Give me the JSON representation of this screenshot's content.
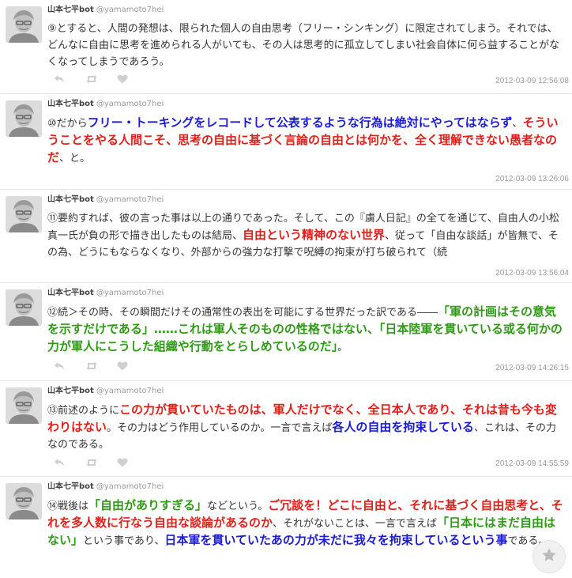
{
  "feed": {
    "tweets": [
      {
        "user_name": "山本七平bot",
        "handle": "@yamamoto7hei",
        "segments": [
          {
            "text": "⑨とすると、人間の発想は、限られた個人の自由思考（フリー・シンキング）に限定されてしまう。それでは、どんなに自由に思考を進められる人がいても、その人は思考的に孤立してしまい社会自体に何ら益することがなくなってしまうであろう。",
            "style": "plain"
          }
        ],
        "timestamp": "2012-03-09 12:56:08"
      },
      {
        "user_name": "山本七平bot",
        "handle": "@yamamoto7hei",
        "segments": [
          {
            "text": "⑩だから",
            "style": "plain"
          },
          {
            "text": "フリー・トーキングをレコードして公表するような行為は絶対にやってはならず",
            "style": "blue"
          },
          {
            "text": "、",
            "style": "plain"
          },
          {
            "text": "そういうことをやる人間こそ、思考の自由に基づく言論の自由とは何かを、全く理解できない愚者なのだ",
            "style": "red"
          },
          {
            "text": "、と。",
            "style": "plain"
          }
        ],
        "timestamp": "2012-03-09 13:26:06"
      },
      {
        "user_name": "山本七平bot",
        "handle": "@yamamoto7hei",
        "segments": [
          {
            "text": "⑪要約すれば、彼の言った事は以上の通りであった。そして、この『虜人日記』の全てを通じて、自由人の小松真一氏が負の形で描き出したものは結局、",
            "style": "plain"
          },
          {
            "text": "自由という精神のない世界",
            "style": "red"
          },
          {
            "text": "、従って「自由な談話」が皆無で、その為、どうにもならなくなり、外部からの強力な打撃で呪縛の拘束が打ち破られて（続",
            "style": "plain"
          }
        ],
        "timestamp": "2012-03-09 13:56:04"
      },
      {
        "user_name": "山本七平bot",
        "handle": "@yamamoto7hei",
        "segments": [
          {
            "text": "⑫続＞その時、その瞬間だけその通常性の表出を可能にする世界だった訳である――",
            "style": "plain"
          },
          {
            "text": "「軍の計画はその意気を示すだけである」……これは軍人そのものの性格ではない、「日本陸軍を貫いている或る何かの力が軍人にこうした組織や行動をとらしめているのだ」",
            "style": "green"
          },
          {
            "text": "。",
            "style": "plain"
          }
        ],
        "timestamp": "2012-03-09 14:26:15"
      },
      {
        "user_name": "山本七平bot",
        "handle": "@yamamoto7hei",
        "segments": [
          {
            "text": "⑬前述のように",
            "style": "plain"
          },
          {
            "text": "この力が貫いていたものは、軍人だけでなく、全日本人であり、それは昔も今も変わりはない",
            "style": "red"
          },
          {
            "text": "。その力はどう作用しているのか。一言で言えば",
            "style": "plain"
          },
          {
            "text": "各人の自由を拘束している",
            "style": "blue"
          },
          {
            "text": "、これは、その力なのである。",
            "style": "plain"
          }
        ],
        "timestamp": "2012-03-09 14:55:59"
      },
      {
        "user_name": "山本七平bot",
        "handle": "@yamamoto7hei",
        "segments": [
          {
            "text": "⑭戦後は",
            "style": "plain"
          },
          {
            "text": "「自由がありすぎる」",
            "style": "green"
          },
          {
            "text": "などという。",
            "style": "plain"
          },
          {
            "text": "ご冗談を！どこに自由と、それに基づく自由思考と、それを多人数に行なう自由な談論があるのか",
            "style": "red"
          },
          {
            "text": "、それがないことは、一言で言えば",
            "style": "plain"
          },
          {
            "text": "「日本にはまだ自由はない」",
            "style": "green"
          },
          {
            "text": "という事であり、",
            "style": "plain"
          },
          {
            "text": "日本軍を貫いていたあの力が未だに我々を拘束しているという事",
            "style": "blue"
          },
          {
            "text": "である。",
            "style": "plain"
          }
        ],
        "timestamp": ""
      }
    ]
  },
  "icons": {
    "reply": "reply-icon",
    "retweet": "retweet-icon",
    "favorite": "heart-icon",
    "floating": "star-icon"
  },
  "colors": {
    "red": "#e0201a",
    "blue": "#1b1bd6",
    "green": "#2e9a15",
    "timestamp": "#999999",
    "icon": "#cfcfcf"
  }
}
